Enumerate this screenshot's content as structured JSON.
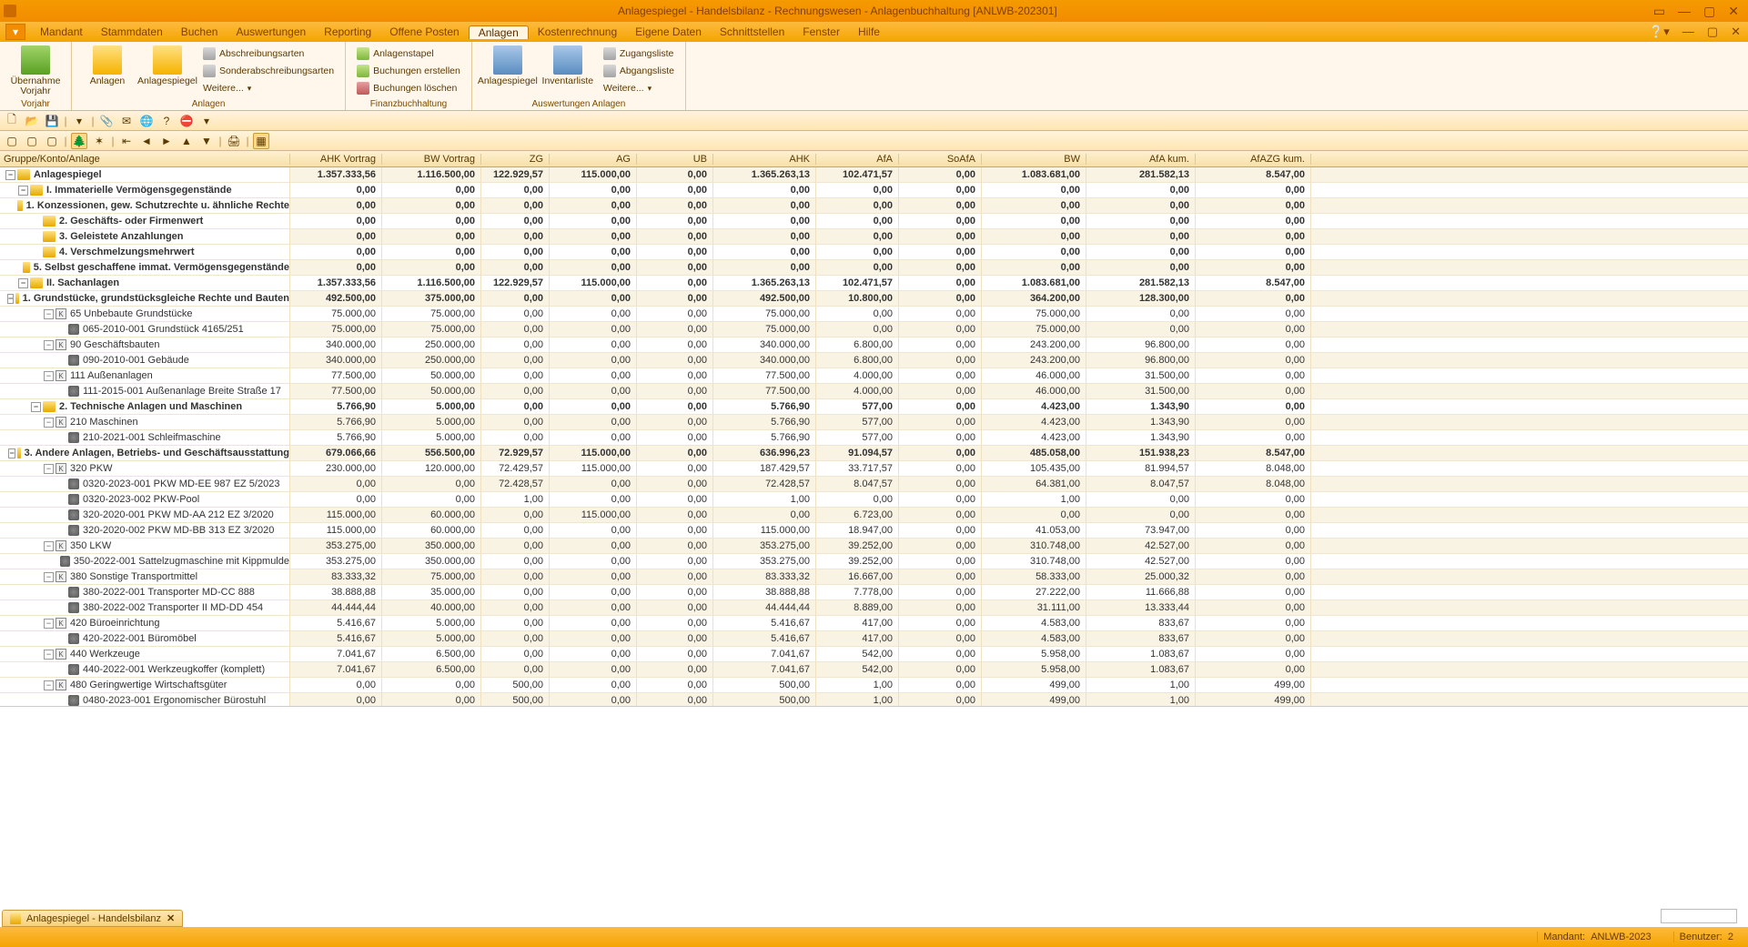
{
  "window": {
    "title": "Anlagespiegel - Handelsbilanz - Rechnungswesen - Anlagenbuchhaltung [ANLWB-202301]"
  },
  "menu": {
    "items": [
      "Mandant",
      "Stammdaten",
      "Buchen",
      "Auswertungen",
      "Reporting",
      "Offene Posten",
      "Anlagen",
      "Kostenrechnung",
      "Eigene Daten",
      "Schnittstellen",
      "Fenster",
      "Hilfe"
    ],
    "active_index": 6
  },
  "ribbon": {
    "groups": [
      {
        "label": "",
        "big": [
          {
            "lbl1": "Übernahme",
            "lbl2": "Vorjahr"
          }
        ]
      },
      {
        "label": "Anlagen",
        "big": [
          {
            "lbl1": "Anlagen"
          },
          {
            "lbl1": "Anlagespiegel"
          }
        ],
        "small_cols": [
          [
            "Abschreibungsarten",
            "Sonderabschreibungsarten",
            "Weitere..."
          ]
        ]
      },
      {
        "label": "Finanzbuchhaltung",
        "small_cols": [
          [
            "Anlagenstapel",
            "Buchungen erstellen",
            "Buchungen löschen"
          ]
        ]
      },
      {
        "label": "Auswertungen Anlagen",
        "big": [
          {
            "lbl1": "Anlagespiegel"
          },
          {
            "lbl1": "Inventarliste"
          }
        ],
        "small_cols": [
          [
            "Zugangsliste",
            "Abgangsliste",
            "Weitere..."
          ]
        ]
      }
    ]
  },
  "grid": {
    "tree_header": "Gruppe/Konto/Anlage",
    "cols": [
      "AHK Vortrag",
      "BW Vortrag",
      "ZG",
      "AG",
      "UB",
      "AHK",
      "AfA",
      "SoAfA",
      "BW",
      "AfA kum.",
      "AfAZG kum."
    ]
  },
  "rows": [
    {
      "d": 0,
      "b": 1,
      "t": "fopen",
      "lbl": "Anlagespiegel",
      "v": [
        "1.357.333,56",
        "1.116.500,00",
        "122.929,57",
        "115.000,00",
        "0,00",
        "1.365.263,13",
        "102.471,57",
        "0,00",
        "1.083.681,00",
        "281.582,13",
        "8.547,00"
      ],
      "s": 1
    },
    {
      "d": 1,
      "b": 1,
      "t": "fopen",
      "lbl": "I. Immaterielle Vermögensgegenstände",
      "v": [
        "0,00",
        "0,00",
        "0,00",
        "0,00",
        "0,00",
        "0,00",
        "0,00",
        "0,00",
        "0,00",
        "0,00",
        "0,00"
      ]
    },
    {
      "d": 2,
      "b": 1,
      "t": "f",
      "lbl": "1. Konzessionen, gew. Schutzrechte u. ähnliche Rechte",
      "v": [
        "0,00",
        "0,00",
        "0,00",
        "0,00",
        "0,00",
        "0,00",
        "0,00",
        "0,00",
        "0,00",
        "0,00",
        "0,00"
      ],
      "s": 1
    },
    {
      "d": 2,
      "b": 1,
      "t": "f",
      "lbl": "2. Geschäfts- oder Firmenwert",
      "v": [
        "0,00",
        "0,00",
        "0,00",
        "0,00",
        "0,00",
        "0,00",
        "0,00",
        "0,00",
        "0,00",
        "0,00",
        "0,00"
      ]
    },
    {
      "d": 2,
      "b": 1,
      "t": "f",
      "lbl": "3. Geleistete Anzahlungen",
      "v": [
        "0,00",
        "0,00",
        "0,00",
        "0,00",
        "0,00",
        "0,00",
        "0,00",
        "0,00",
        "0,00",
        "0,00",
        "0,00"
      ],
      "s": 1
    },
    {
      "d": 2,
      "b": 1,
      "t": "f",
      "lbl": "4. Verschmelzungsmehrwert",
      "v": [
        "0,00",
        "0,00",
        "0,00",
        "0,00",
        "0,00",
        "0,00",
        "0,00",
        "0,00",
        "0,00",
        "0,00",
        "0,00"
      ]
    },
    {
      "d": 2,
      "b": 1,
      "t": "f",
      "lbl": "5. Selbst geschaffene immat. Vermögensgegenstände",
      "v": [
        "0,00",
        "0,00",
        "0,00",
        "0,00",
        "0,00",
        "0,00",
        "0,00",
        "0,00",
        "0,00",
        "0,00",
        "0,00"
      ],
      "s": 1
    },
    {
      "d": 1,
      "b": 1,
      "t": "fopen",
      "lbl": "II. Sachanlagen",
      "v": [
        "1.357.333,56",
        "1.116.500,00",
        "122.929,57",
        "115.000,00",
        "0,00",
        "1.365.263,13",
        "102.471,57",
        "0,00",
        "1.083.681,00",
        "281.582,13",
        "8.547,00"
      ]
    },
    {
      "d": 2,
      "b": 1,
      "t": "fopen",
      "lbl": "1. Grundstücke, grundstücksgleiche Rechte und Bauten",
      "v": [
        "492.500,00",
        "375.000,00",
        "0,00",
        "0,00",
        "0,00",
        "492.500,00",
        "10.800,00",
        "0,00",
        "364.200,00",
        "128.300,00",
        "0,00"
      ],
      "s": 1
    },
    {
      "d": 3,
      "t": "kopen",
      "lbl": "65 Unbebaute Grundstücke",
      "v": [
        "75.000,00",
        "75.000,00",
        "0,00",
        "0,00",
        "0,00",
        "75.000,00",
        "0,00",
        "0,00",
        "75.000,00",
        "0,00",
        "0,00"
      ]
    },
    {
      "d": 4,
      "t": "a",
      "lbl": "065-2010-001 Grundstück 4165/251",
      "v": [
        "75.000,00",
        "75.000,00",
        "0,00",
        "0,00",
        "0,00",
        "75.000,00",
        "0,00",
        "0,00",
        "75.000,00",
        "0,00",
        "0,00"
      ],
      "s": 1
    },
    {
      "d": 3,
      "t": "kopen",
      "lbl": "90 Geschäftsbauten",
      "v": [
        "340.000,00",
        "250.000,00",
        "0,00",
        "0,00",
        "0,00",
        "340.000,00",
        "6.800,00",
        "0,00",
        "243.200,00",
        "96.800,00",
        "0,00"
      ]
    },
    {
      "d": 4,
      "t": "a",
      "lbl": "090-2010-001 Gebäude",
      "v": [
        "340.000,00",
        "250.000,00",
        "0,00",
        "0,00",
        "0,00",
        "340.000,00",
        "6.800,00",
        "0,00",
        "243.200,00",
        "96.800,00",
        "0,00"
      ],
      "s": 1
    },
    {
      "d": 3,
      "t": "kopen",
      "lbl": "111 Außenanlagen",
      "v": [
        "77.500,00",
        "50.000,00",
        "0,00",
        "0,00",
        "0,00",
        "77.500,00",
        "4.000,00",
        "0,00",
        "46.000,00",
        "31.500,00",
        "0,00"
      ]
    },
    {
      "d": 4,
      "t": "a",
      "lbl": "111-2015-001 Außenanlage Breite Straße 17",
      "v": [
        "77.500,00",
        "50.000,00",
        "0,00",
        "0,00",
        "0,00",
        "77.500,00",
        "4.000,00",
        "0,00",
        "46.000,00",
        "31.500,00",
        "0,00"
      ],
      "s": 1
    },
    {
      "d": 2,
      "b": 1,
      "t": "fopen",
      "lbl": "2. Technische Anlagen und Maschinen",
      "v": [
        "5.766,90",
        "5.000,00",
        "0,00",
        "0,00",
        "0,00",
        "5.766,90",
        "577,00",
        "0,00",
        "4.423,00",
        "1.343,90",
        "0,00"
      ]
    },
    {
      "d": 3,
      "t": "kopen",
      "lbl": "210 Maschinen",
      "v": [
        "5.766,90",
        "5.000,00",
        "0,00",
        "0,00",
        "0,00",
        "5.766,90",
        "577,00",
        "0,00",
        "4.423,00",
        "1.343,90",
        "0,00"
      ],
      "s": 1
    },
    {
      "d": 4,
      "t": "a",
      "lbl": "210-2021-001 Schleifmaschine",
      "v": [
        "5.766,90",
        "5.000,00",
        "0,00",
        "0,00",
        "0,00",
        "5.766,90",
        "577,00",
        "0,00",
        "4.423,00",
        "1.343,90",
        "0,00"
      ]
    },
    {
      "d": 2,
      "b": 1,
      "t": "fopen",
      "lbl": "3. Andere Anlagen, Betriebs- und Geschäftsausstattung",
      "v": [
        "679.066,66",
        "556.500,00",
        "72.929,57",
        "115.000,00",
        "0,00",
        "636.996,23",
        "91.094,57",
        "0,00",
        "485.058,00",
        "151.938,23",
        "8.547,00"
      ],
      "s": 1
    },
    {
      "d": 3,
      "t": "kopen",
      "lbl": "320 PKW",
      "v": [
        "230.000,00",
        "120.000,00",
        "72.429,57",
        "115.000,00",
        "0,00",
        "187.429,57",
        "33.717,57",
        "0,00",
        "105.435,00",
        "81.994,57",
        "8.048,00"
      ]
    },
    {
      "d": 4,
      "t": "a",
      "lbl": "0320-2023-001 PKW MD-EE 987 EZ 5/2023",
      "v": [
        "0,00",
        "0,00",
        "72.428,57",
        "0,00",
        "0,00",
        "72.428,57",
        "8.047,57",
        "0,00",
        "64.381,00",
        "8.047,57",
        "8.048,00"
      ],
      "s": 1
    },
    {
      "d": 4,
      "t": "a",
      "lbl": "0320-2023-002 PKW-Pool",
      "v": [
        "0,00",
        "0,00",
        "1,00",
        "0,00",
        "0,00",
        "1,00",
        "0,00",
        "0,00",
        "1,00",
        "0,00",
        "0,00"
      ]
    },
    {
      "d": 4,
      "t": "a",
      "lbl": "320-2020-001 PKW MD-AA 212 EZ 3/2020",
      "v": [
        "115.000,00",
        "60.000,00",
        "0,00",
        "115.000,00",
        "0,00",
        "0,00",
        "6.723,00",
        "0,00",
        "0,00",
        "0,00",
        "0,00"
      ],
      "s": 1
    },
    {
      "d": 4,
      "t": "a",
      "lbl": "320-2020-002 PKW MD-BB 313 EZ 3/2020",
      "v": [
        "115.000,00",
        "60.000,00",
        "0,00",
        "0,00",
        "0,00",
        "115.000,00",
        "18.947,00",
        "0,00",
        "41.053,00",
        "73.947,00",
        "0,00"
      ]
    },
    {
      "d": 3,
      "t": "kopen",
      "lbl": "350 LKW",
      "v": [
        "353.275,00",
        "350.000,00",
        "0,00",
        "0,00",
        "0,00",
        "353.275,00",
        "39.252,00",
        "0,00",
        "310.748,00",
        "42.527,00",
        "0,00"
      ],
      "s": 1
    },
    {
      "d": 4,
      "t": "a",
      "lbl": "350-2022-001 Sattelzugmaschine mit Kippmulde",
      "v": [
        "353.275,00",
        "350.000,00",
        "0,00",
        "0,00",
        "0,00",
        "353.275,00",
        "39.252,00",
        "0,00",
        "310.748,00",
        "42.527,00",
        "0,00"
      ]
    },
    {
      "d": 3,
      "t": "kopen",
      "lbl": "380 Sonstige Transportmittel",
      "v": [
        "83.333,32",
        "75.000,00",
        "0,00",
        "0,00",
        "0,00",
        "83.333,32",
        "16.667,00",
        "0,00",
        "58.333,00",
        "25.000,32",
        "0,00"
      ],
      "s": 1
    },
    {
      "d": 4,
      "t": "a",
      "lbl": "380-2022-001 Transporter MD-CC 888",
      "v": [
        "38.888,88",
        "35.000,00",
        "0,00",
        "0,00",
        "0,00",
        "38.888,88",
        "7.778,00",
        "0,00",
        "27.222,00",
        "11.666,88",
        "0,00"
      ]
    },
    {
      "d": 4,
      "t": "a",
      "lbl": "380-2022-002 Transporter II MD-DD 454",
      "v": [
        "44.444,44",
        "40.000,00",
        "0,00",
        "0,00",
        "0,00",
        "44.444,44",
        "8.889,00",
        "0,00",
        "31.111,00",
        "13.333,44",
        "0,00"
      ],
      "s": 1
    },
    {
      "d": 3,
      "t": "kopen",
      "lbl": "420 Büroeinrichtung",
      "v": [
        "5.416,67",
        "5.000,00",
        "0,00",
        "0,00",
        "0,00",
        "5.416,67",
        "417,00",
        "0,00",
        "4.583,00",
        "833,67",
        "0,00"
      ]
    },
    {
      "d": 4,
      "t": "a",
      "lbl": "420-2022-001 Büromöbel",
      "v": [
        "5.416,67",
        "5.000,00",
        "0,00",
        "0,00",
        "0,00",
        "5.416,67",
        "417,00",
        "0,00",
        "4.583,00",
        "833,67",
        "0,00"
      ],
      "s": 1
    },
    {
      "d": 3,
      "t": "kopen",
      "lbl": "440 Werkzeuge",
      "v": [
        "7.041,67",
        "6.500,00",
        "0,00",
        "0,00",
        "0,00",
        "7.041,67",
        "542,00",
        "0,00",
        "5.958,00",
        "1.083,67",
        "0,00"
      ]
    },
    {
      "d": 4,
      "t": "a",
      "lbl": "440-2022-001 Werkzeugkoffer (komplett)",
      "v": [
        "7.041,67",
        "6.500,00",
        "0,00",
        "0,00",
        "0,00",
        "7.041,67",
        "542,00",
        "0,00",
        "5.958,00",
        "1.083,67",
        "0,00"
      ],
      "s": 1
    },
    {
      "d": 3,
      "t": "kopen",
      "lbl": "480 Geringwertige Wirtschaftsgüter",
      "v": [
        "0,00",
        "0,00",
        "500,00",
        "0,00",
        "0,00",
        "500,00",
        "1,00",
        "0,00",
        "499,00",
        "1,00",
        "499,00"
      ]
    },
    {
      "d": 4,
      "t": "a",
      "lbl": "0480-2023-001 Ergonomischer Bürostuhl",
      "v": [
        "0,00",
        "0,00",
        "500,00",
        "0,00",
        "0,00",
        "500,00",
        "1,00",
        "0,00",
        "499,00",
        "1,00",
        "499,00"
      ],
      "s": 1
    }
  ],
  "bottom_tab": {
    "label": "Anlagespiegel - Handelsbilanz"
  },
  "status": {
    "mandant_lbl": "Mandant:",
    "mandant": "ANLWB-2023",
    "benutzer_lbl": "Benutzer:",
    "benutzer": "2"
  }
}
